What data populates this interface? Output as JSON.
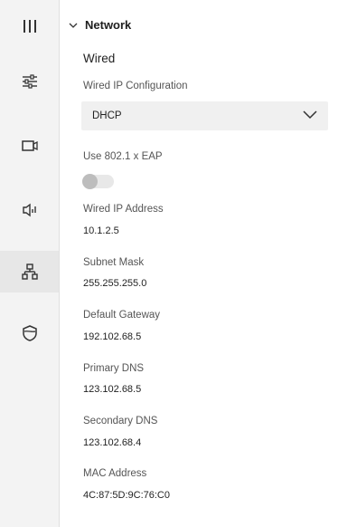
{
  "sidebar": {
    "items": [
      {
        "icon": "collapse-columns-icon",
        "active": false
      },
      {
        "icon": "sliders-icon",
        "active": false
      },
      {
        "icon": "camera-icon",
        "active": false
      },
      {
        "icon": "speaker-icon",
        "active": false
      },
      {
        "icon": "network-icon",
        "active": true
      },
      {
        "icon": "shield-icon",
        "active": false
      }
    ]
  },
  "section": {
    "title": "Network",
    "expanded": true
  },
  "wired": {
    "heading": "Wired",
    "ip_config_label": "Wired IP Configuration",
    "ip_config_value": "DHCP",
    "eap_label": "Use 802.1 x EAP",
    "eap_enabled": false,
    "ip_address_label": "Wired IP Address",
    "ip_address_value": "10.1.2.5",
    "subnet_label": "Subnet Mask",
    "subnet_value": "255.255.255.0",
    "gateway_label": "Default Gateway",
    "gateway_value": "192.102.68.5",
    "primary_dns_label": "Primary DNS",
    "primary_dns_value": "123.102.68.5",
    "secondary_dns_label": "Secondary DNS",
    "secondary_dns_value": "123.102.68.4",
    "mac_label": "MAC Address",
    "mac_value": "4C:87:5D:9C:76:C0"
  },
  "colors": {
    "rail_bg": "#f3f3f3",
    "rail_active": "#e7e7e7",
    "select_bg": "#f0f0f0",
    "label": "#555555",
    "text": "#1f1f1f"
  }
}
